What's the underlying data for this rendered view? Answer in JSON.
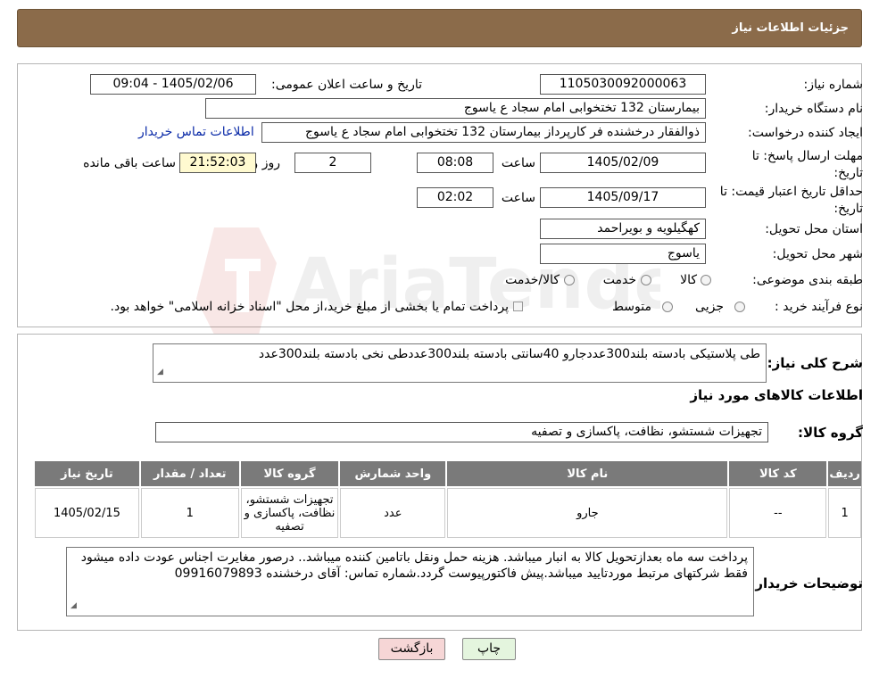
{
  "header": {
    "title": "جزئیات اطلاعات نیاز"
  },
  "watermark": {
    "text": "AriaTender.neT"
  },
  "form": {
    "need_number": {
      "label": "شماره نیاز:",
      "value": "1105030092000063"
    },
    "announce_datetime": {
      "label": "تاریخ و ساعت اعلان عمومی:",
      "value": "1405/02/06 - 09:04"
    },
    "buyer_org": {
      "label": "نام دستگاه خریدار:",
      "value": "بیمارستان 132 تختخوابی امام سجاد  ع  یاسوج"
    },
    "requester": {
      "label": "ایجاد کننده درخواست:",
      "value": "ذوالفقار درخشنده فر کارپرداز بیمارستان 132 تختخوابی امام سجاد  ع  یاسوج",
      "contact_link": "اطلاعات تماس خریدار"
    },
    "reply_deadline": {
      "label_line1": "مهلت ارسال پاسخ: تا",
      "label_line2": "تاریخ:",
      "date": "1405/02/09",
      "time_label": "ساعت",
      "time": "08:08",
      "days": "2",
      "days_label": "روز و",
      "remaining": "21:52:03",
      "remaining_label": "ساعت باقی مانده"
    },
    "price_validity": {
      "label_line1": "حداقل تاریخ اعتبار قیمت: تا",
      "label_line2": "تاریخ:",
      "date": "1405/09/17",
      "time_label": "ساعت",
      "time": "02:02"
    },
    "province": {
      "label": "استان محل تحویل:",
      "value": "کهگیلویه و بویراحمد"
    },
    "city": {
      "label": "شهر محل تحویل:",
      "value": "یاسوج"
    },
    "category": {
      "label": "طبقه بندی موضوعی:",
      "options": [
        "کالا",
        "خدمت",
        "کالا/خدمت"
      ]
    },
    "purchase_type": {
      "label": "نوع فرآیند خرید :",
      "options": [
        "جزیی",
        "متوسط"
      ],
      "note": "پرداخت تمام یا بخشی از مبلغ خرید،از محل \"اسناد خزانه اسلامی\" خواهد بود."
    }
  },
  "summary": {
    "label": "شرح کلی نیاز:",
    "value": "طی پلاستیکی  بادسته بلند300عددجارو 40سانتی بادسته بلند300عددطی نخی بادسته بلند300عدد"
  },
  "goods_info": {
    "title": "اطلاعات کالاهای مورد نیاز"
  },
  "goods_group": {
    "label": "گروه کالا:",
    "value": "تجهیزات شستشو، نظافت، پاکسازی و تصفیه"
  },
  "table": {
    "headers": [
      "ردیف",
      "کد کالا",
      "نام کالا",
      "واحد شمارش",
      "گروه کالا",
      "تعداد / مقدار",
      "تاریخ نیاز"
    ],
    "rows": [
      [
        "1",
        "--",
        "جارو",
        "عدد",
        "تجهیزات شستشو، نظافت، پاکسازی و تصفیه",
        "1",
        "1405/02/15"
      ]
    ]
  },
  "buyer_notes": {
    "label": "توضیحات خریدار:",
    "value": "پرداخت سه ماه بعدازتحویل کالا به انبار میباشد. هزینه حمل ونقل باتامین کننده میباشد.. درصور مغایرت اجناس عودت داده میشود فقط شرکتهای مرتبط موردتایید میباشد.پیش فاکتورپیوست گردد.شماره تماس: آقای درخشنده 09916079893"
  },
  "buttons": {
    "print": "چاپ",
    "back": "بازگشت"
  },
  "colors": {
    "header_bg": "#8b6b4a",
    "table_header_bg": "#7a7a7a",
    "yellow_field": "#fffad0",
    "back_button_bg": "#f6d6d6",
    "print_button_bg": "#e4f5de"
  }
}
